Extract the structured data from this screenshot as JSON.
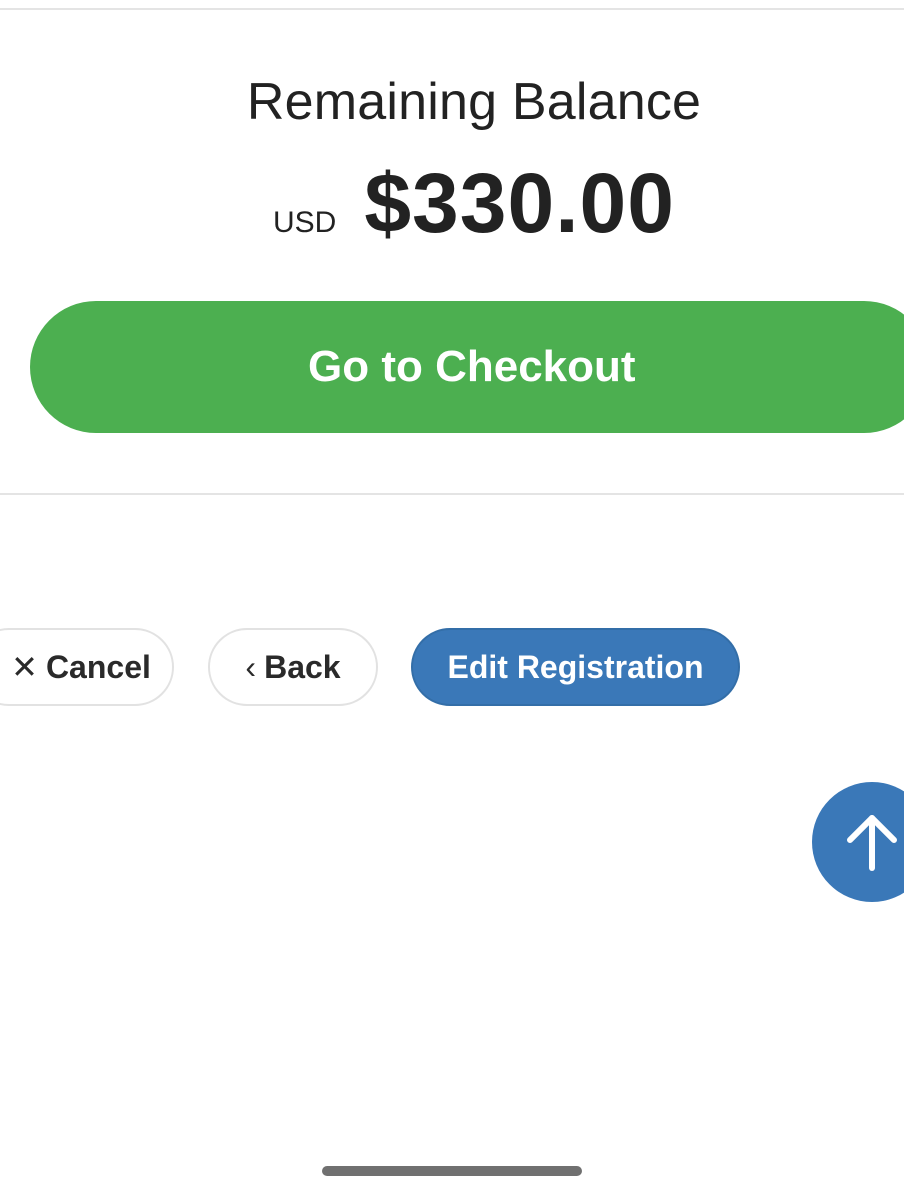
{
  "balance": {
    "title": "Remaining Balance",
    "currency": "USD",
    "amount": "$330.00"
  },
  "checkout": {
    "label": "Go to Checkout",
    "color": "#4caf50"
  },
  "actions": {
    "cancel_label": "Cancel",
    "cancel_icon": "close-icon",
    "back_label": "Back",
    "back_icon": "chevron-left-icon",
    "edit_label": "Edit Registration",
    "edit_color": "#3a78b8"
  },
  "scroll_top": {
    "icon": "arrow-up-icon",
    "color": "#3a78b8"
  }
}
